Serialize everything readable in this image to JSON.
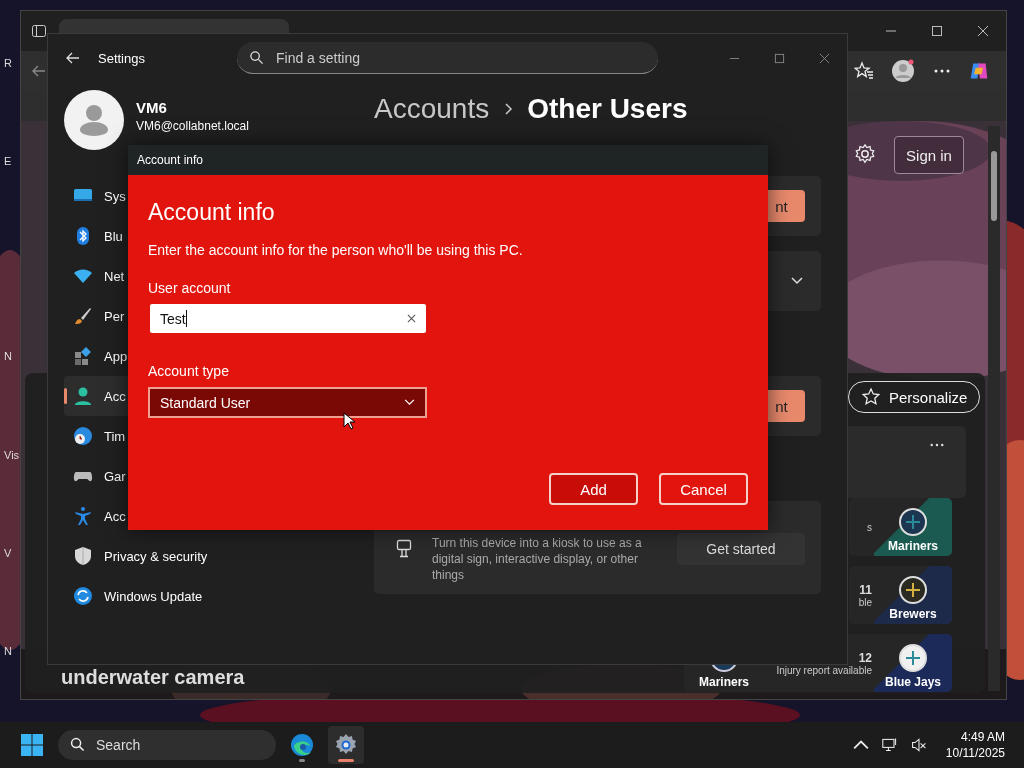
{
  "desktop": {
    "icon_labels": [
      "R",
      "E",
      "N",
      "Vis",
      "V",
      "N"
    ]
  },
  "browser": {
    "sign_in_button": "Sign in",
    "personalize_button": "Personalize",
    "headline": "underwater camera",
    "games": [
      {
        "right_team": "Mariners",
        "status": "s"
      },
      {
        "right_team": "Brewers",
        "score": "11",
        "status": "ble"
      },
      {
        "left_team": "Mariners",
        "right_team": "Blue Jays",
        "score": "12",
        "status": "Injury report available"
      }
    ]
  },
  "settings": {
    "title": "Settings",
    "search_placeholder": "Find a setting",
    "user": {
      "name": "VM6",
      "email": "VM6@collabnet.local"
    },
    "breadcrumb": [
      {
        "label": "Accounts",
        "current": false
      },
      {
        "label": "Other Users",
        "current": true
      }
    ],
    "nav": [
      {
        "label": "Sys",
        "selected": false
      },
      {
        "label": "Blu",
        "selected": false
      },
      {
        "label": "Net",
        "selected": false
      },
      {
        "label": "Per",
        "selected": false
      },
      {
        "label": "App",
        "selected": false
      },
      {
        "label": "Acc",
        "selected": true
      },
      {
        "label": "Tim",
        "selected": false
      },
      {
        "label": "Gar",
        "selected": false
      },
      {
        "label": "Acc",
        "selected": false
      },
      {
        "label": "Privacy & security",
        "selected": false
      },
      {
        "label": "Windows Update",
        "selected": false
      }
    ],
    "cards": [
      {
        "kind": "button",
        "button": "nt"
      },
      {
        "kind": "expander"
      },
      {
        "kind": "button",
        "button": "nt"
      },
      {
        "kind": "kiosk",
        "description": "Turn this device into a kiosk to use as a digital sign, interactive display, or other things",
        "button": "Get started"
      }
    ]
  },
  "dialog": {
    "window_title": "Account info",
    "heading": "Account info",
    "description": "Enter the account info for the person who'll be using this PC.",
    "fields": [
      {
        "kind": "text",
        "label": "User account",
        "value": "Test"
      },
      {
        "kind": "select",
        "label": "Account type",
        "value": "Standard User"
      }
    ],
    "buttons": [
      {
        "label": "Add",
        "default": true
      },
      {
        "label": "Cancel",
        "default": false
      }
    ]
  },
  "taskbar": {
    "search_placeholder": "Search",
    "apps": [
      {
        "kind": "browser",
        "active": false
      },
      {
        "kind": "settings",
        "active": true
      }
    ],
    "time": "4:49 AM",
    "date": "10/11/2025"
  }
}
